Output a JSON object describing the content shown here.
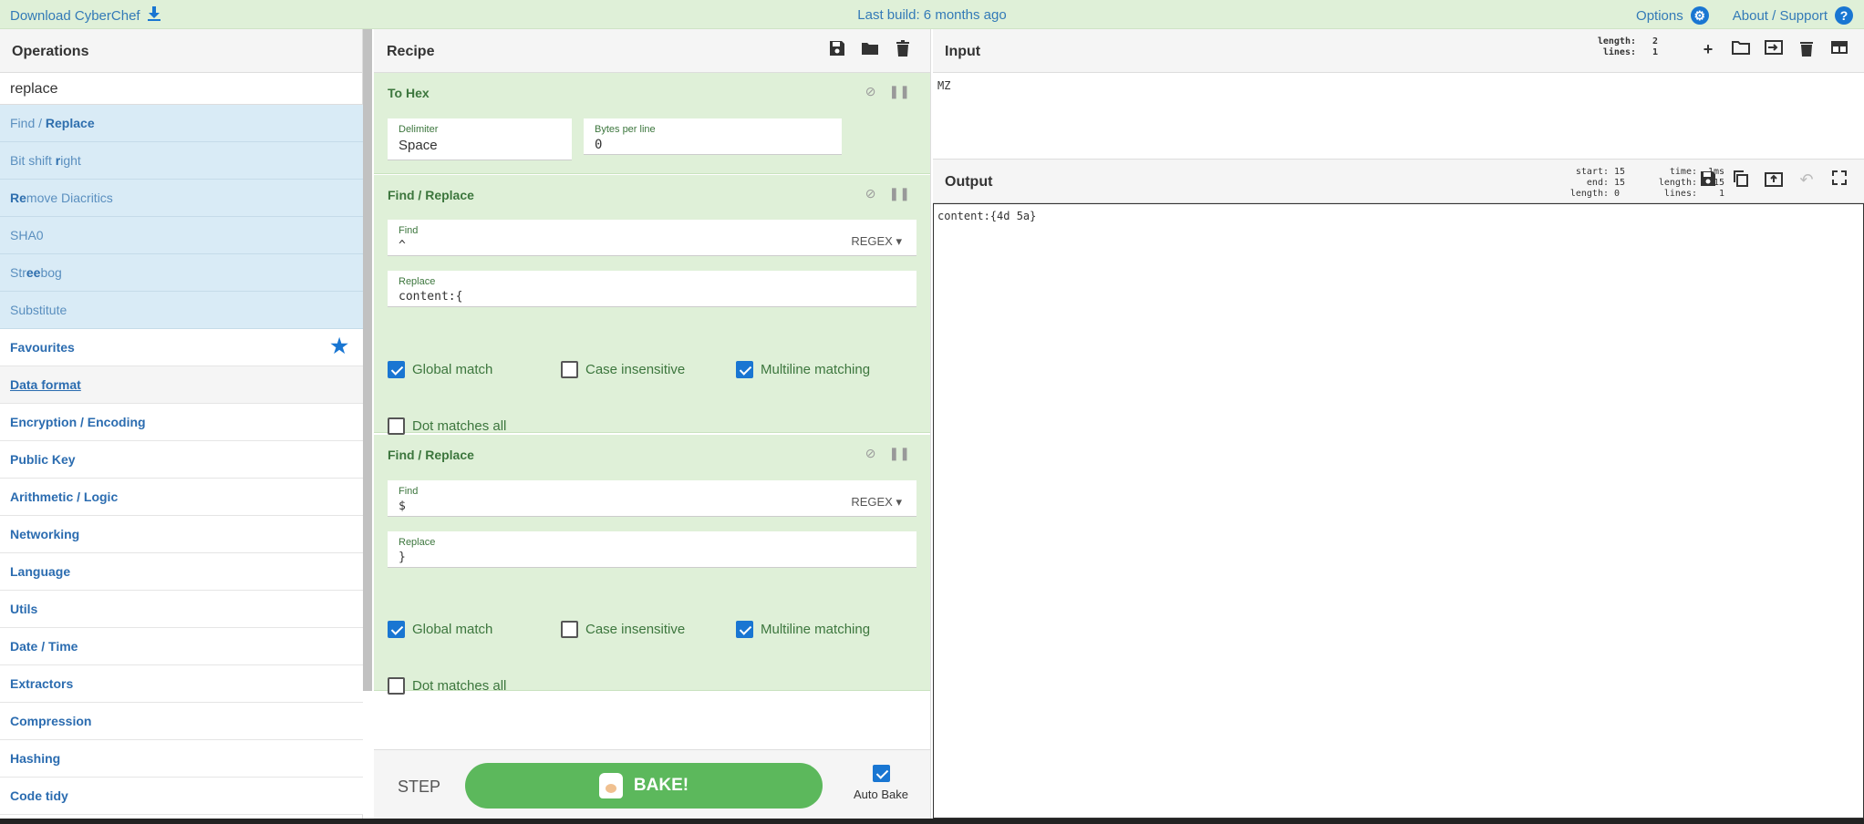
{
  "banner": {
    "download": "Download CyberChef",
    "build": "Last build: 6 months ago",
    "options": "Options",
    "about": "About / Support"
  },
  "operations": {
    "title": "Operations",
    "search_value": "replace",
    "results": [
      {
        "pre": "Find / ",
        "hl": "Replace",
        "post": ""
      },
      {
        "pre": "Bit shift ",
        "hl": "r",
        "post": "ight"
      },
      {
        "pre": "",
        "hl": "Re",
        "post": "move Diacritics"
      },
      {
        "pre": "SHA0",
        "hl": "",
        "post": ""
      },
      {
        "pre": "Str",
        "hl": "ee",
        "post": "bog"
      },
      {
        "pre": "Substitute",
        "hl": "",
        "post": ""
      }
    ],
    "categories": [
      "Favourites",
      "Data format",
      "Encryption / Encoding",
      "Public Key",
      "Arithmetic / Logic",
      "Networking",
      "Language",
      "Utils",
      "Date / Time",
      "Extractors",
      "Compression",
      "Hashing",
      "Code tidy"
    ]
  },
  "recipe": {
    "title": "Recipe",
    "to_hex": {
      "title": "To Hex",
      "delimiter_label": "Delimiter",
      "delimiter_value": "Space",
      "bpl_label": "Bytes per line",
      "bpl_value": "0"
    },
    "fr1": {
      "title": "Find / Replace",
      "find_label": "Find",
      "find_value": "^",
      "find_mode": "REGEX",
      "replace_label": "Replace",
      "replace_value": "content:{",
      "global": "Global match",
      "case": "Case insensitive",
      "multiline": "Multiline matching",
      "dotall": "Dot matches all"
    },
    "fr2": {
      "title": "Find / Replace",
      "find_label": "Find",
      "find_value": "$",
      "find_mode": "REGEX",
      "replace_label": "Replace",
      "replace_value": "}",
      "global": "Global match",
      "case": "Case insensitive",
      "multiline": "Multiline matching",
      "dotall": "Dot matches all"
    },
    "step": "STEP",
    "bake": "BAKE!",
    "autobake": "Auto Bake"
  },
  "input": {
    "title": "Input",
    "stats_labels": "length:\nlines:",
    "stats_values": "2\n1",
    "value": "MZ"
  },
  "output": {
    "title": "Output",
    "stats1_labels": "start:\n  end:\nlength:",
    "stats1_values": "15\n15\n0",
    "stats2_labels": "time:\nlength:\nlines:",
    "stats2_values": "1ms\n15\n1",
    "value": "content:{4d 5a}"
  }
}
